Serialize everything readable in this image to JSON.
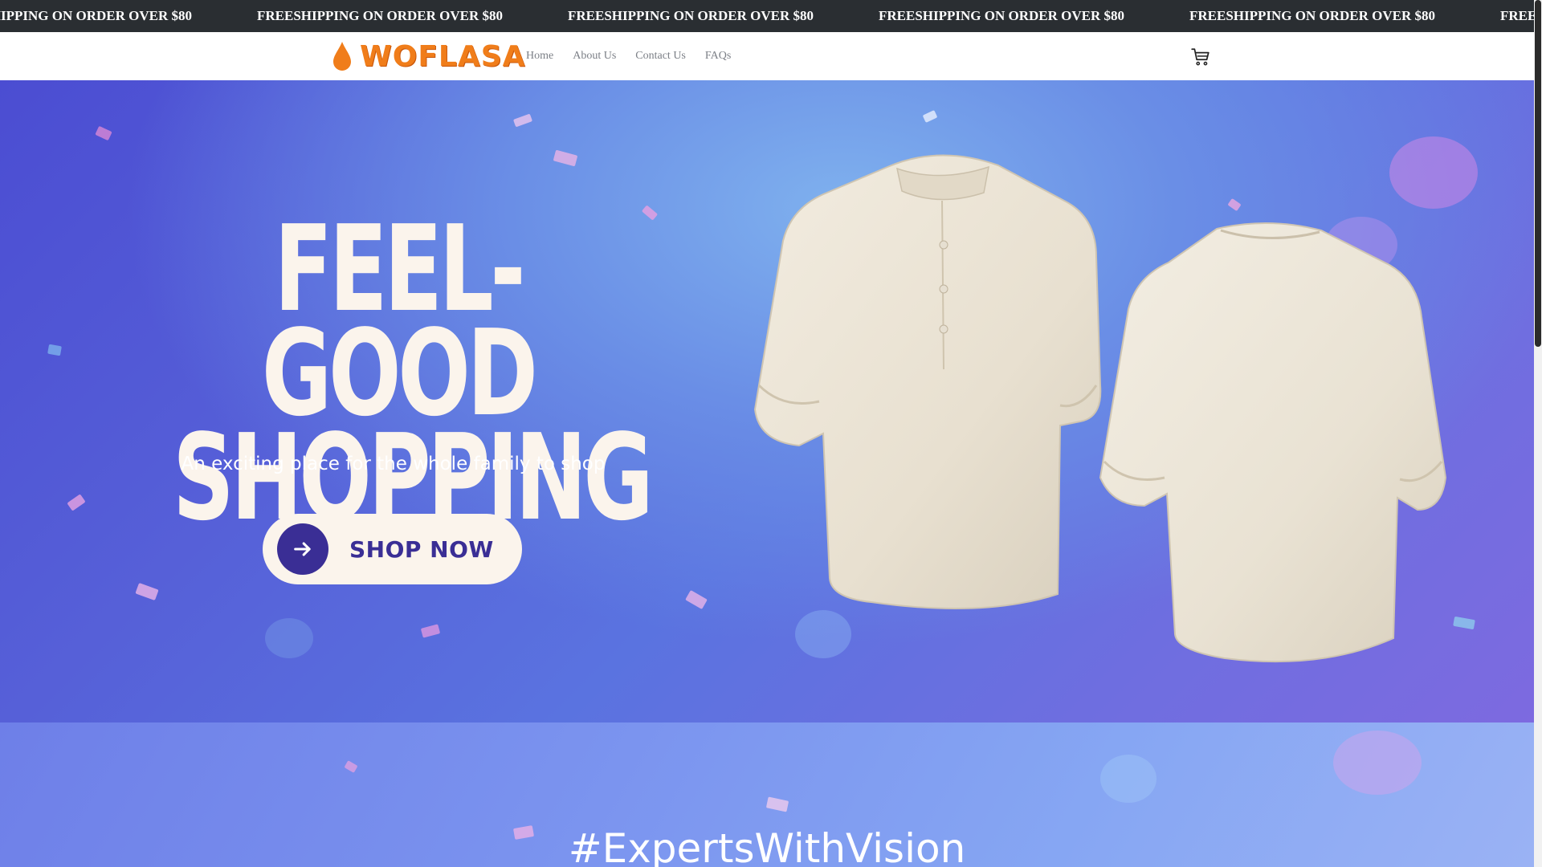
{
  "announcement": {
    "text": "FREESHIPPING ON ORDER OVER $80",
    "background": "#2a2e32"
  },
  "header": {
    "logo_text": "WOFLASA",
    "logo_color": "#f07d1a",
    "nav": [
      {
        "label": "Home"
      },
      {
        "label": "About Us"
      },
      {
        "label": "Contact Us"
      },
      {
        "label": "FAQs"
      }
    ],
    "cart_icon": "shopping-cart-icon"
  },
  "hero": {
    "headline_line1": "FEEL-GOOD",
    "headline_line2": "SHOPPING",
    "subtitle": "An exciting place for the whole family to shop",
    "cta_label": "SHOP NOW",
    "cta_icon": "arrow-right-icon",
    "accent": "#3a2e95",
    "cream": "#fbf4ec"
  },
  "section2": {
    "tagline": "#ExpertsWithVision"
  }
}
